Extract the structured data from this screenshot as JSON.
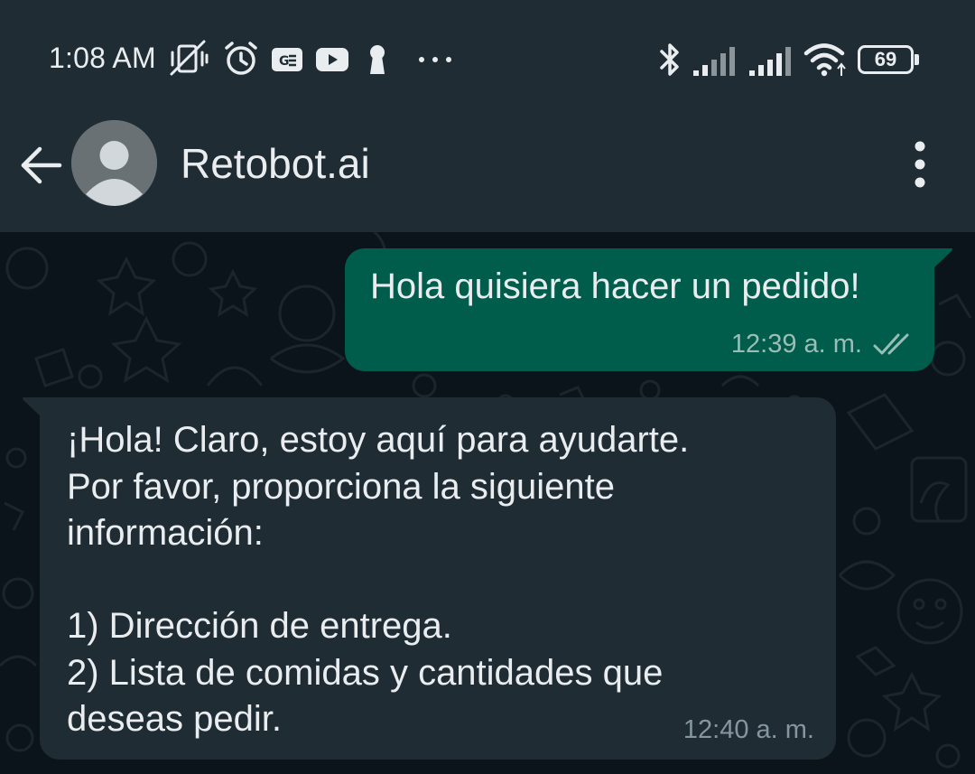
{
  "status_bar": {
    "time": "1:08 AM",
    "battery": "69",
    "battery_level_percent": 69,
    "icons": [
      "vibrate-off-icon",
      "alarm-icon",
      "ge-badge-icon",
      "youtube-icon",
      "keyhole-icon",
      "more-notifications-icon",
      "bluetooth-icon",
      "signal-icon",
      "signal-icon",
      "wifi-icon",
      "battery-icon"
    ]
  },
  "header": {
    "back_icon": "arrow-left-icon",
    "avatar_icon": "default-avatar-icon",
    "contact_name": "Retobot.ai",
    "menu_icon": "more-vertical-icon"
  },
  "messages": [
    {
      "direction": "outgoing",
      "text": "Hola quisiera hacer un pedido!",
      "time": "12:39 a. m.",
      "status_icon": "double-check-icon"
    },
    {
      "direction": "incoming",
      "text": "¡Hola! Claro, estoy aquí para ayudarte.\nPor favor, proporciona la siguiente\ninformación:\n\n1) Dirección de entrega.\n2) Lista de comidas y cantidades que\ndeseas pedir.",
      "time": "12:40 a. m."
    }
  ],
  "colors": {
    "header_bg": "#1f2c34",
    "chat_bg": "#0b141a",
    "outgoing_bubble": "#005c4b",
    "incoming_bubble": "#1f2c34",
    "text": "#e9edef"
  }
}
